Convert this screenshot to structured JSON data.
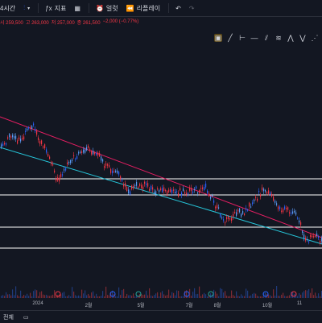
{
  "toolbar": {
    "interval_label": "4시간",
    "indicators_label": "지표",
    "alert_label": "얼럿",
    "replay_label": "리플레이"
  },
  "ohlc": {
    "open": "시 259,500",
    "high": "고 263,000",
    "low": "저 257,000",
    "close": "종 261,500",
    "change": "−2,000 (−0.77%)"
  },
  "xaxis": {
    "labels": [
      "2024",
      "2월",
      "5월",
      "7월",
      "8월",
      "10월",
      "11"
    ]
  },
  "bottom": {
    "range_label": "전체"
  },
  "colors": {
    "background": "#131722",
    "up": "#f23645",
    "down": "#2962ff",
    "down_alt": "#5b9cf6",
    "trend_upper": "#e91e63",
    "trend_lower": "#26c6da",
    "hline": "#ffffff"
  }
}
